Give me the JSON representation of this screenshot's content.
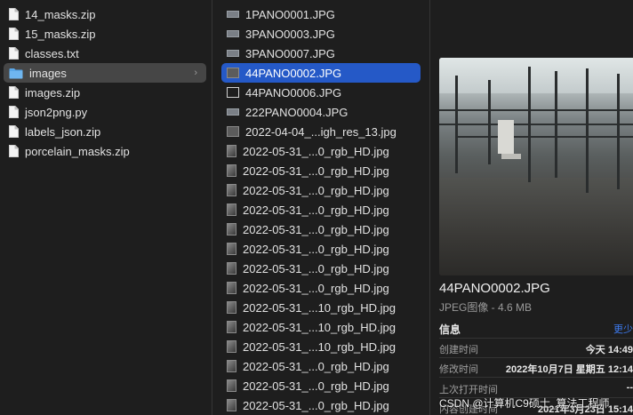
{
  "sidebar": {
    "items": [
      {
        "label": "14_masks.zip",
        "icon": "document-icon"
      },
      {
        "label": "15_masks.zip",
        "icon": "document-icon"
      },
      {
        "label": "classes.txt",
        "icon": "document-icon"
      },
      {
        "label": "images",
        "icon": "folder-icon",
        "selected": true
      },
      {
        "label": "images.zip",
        "icon": "document-icon"
      },
      {
        "label": "json2png.py",
        "icon": "document-icon"
      },
      {
        "label": "labels_json.zip",
        "icon": "document-icon"
      },
      {
        "label": "porcelain_masks.zip",
        "icon": "document-icon"
      }
    ],
    "chevron": "›"
  },
  "files": {
    "items": [
      {
        "label": "1PANO0001.JPG",
        "thumb": "pano"
      },
      {
        "label": "3PANO0003.JPG",
        "thumb": "pano"
      },
      {
        "label": "3PANO0007.JPG",
        "thumb": "pano"
      },
      {
        "label": "44PANO0002.JPG",
        "thumb": "dark",
        "selected": true
      },
      {
        "label": "44PANO0006.JPG",
        "thumb": "white"
      },
      {
        "label": "222PANO0004.JPG",
        "thumb": "pano"
      },
      {
        "label": "2022-04-04_...igh_res_13.jpg",
        "thumb": "dark"
      },
      {
        "label": "2022-05-31_...0_rgb_HD.jpg",
        "thumb": "portrait"
      },
      {
        "label": "2022-05-31_...0_rgb_HD.jpg",
        "thumb": "portrait"
      },
      {
        "label": "2022-05-31_...0_rgb_HD.jpg",
        "thumb": "portrait"
      },
      {
        "label": "2022-05-31_...0_rgb_HD.jpg",
        "thumb": "portrait"
      },
      {
        "label": "2022-05-31_...0_rgb_HD.jpg",
        "thumb": "portrait"
      },
      {
        "label": "2022-05-31_...0_rgb_HD.jpg",
        "thumb": "portrait"
      },
      {
        "label": "2022-05-31_...0_rgb_HD.jpg",
        "thumb": "portrait"
      },
      {
        "label": "2022-05-31_...0_rgb_HD.jpg",
        "thumb": "portrait"
      },
      {
        "label": "2022-05-31_...10_rgb_HD.jpg",
        "thumb": "portrait"
      },
      {
        "label": "2022-05-31_...10_rgb_HD.jpg",
        "thumb": "portrait"
      },
      {
        "label": "2022-05-31_...10_rgb_HD.jpg",
        "thumb": "portrait"
      },
      {
        "label": "2022-05-31_...0_rgb_HD.jpg",
        "thumb": "portrait"
      },
      {
        "label": "2022-05-31_...0_rgb_HD.jpg",
        "thumb": "portrait"
      },
      {
        "label": "2022-05-31_...0_rgb_HD.jpg",
        "thumb": "portrait"
      }
    ]
  },
  "preview": {
    "file_name": "44PANO0002.JPG",
    "file_kind": "JPEG图像 - 4.6 MB",
    "info_heading": "信息",
    "more_label": "更少",
    "meta": [
      {
        "key": "创建时间",
        "value": "今天 14:49"
      },
      {
        "key": "修改时间",
        "value": "2022年10月7日 星期五 12:14"
      },
      {
        "key": "上次打开时间",
        "value": "--"
      },
      {
        "key": "内容创建时间",
        "value": "2021年3月23日 15:14"
      }
    ]
  },
  "watermark": "CSDN @计算机C9硕士_算法工程师",
  "colors": {
    "selection_blue": "#2559c7",
    "selection_gray": "#464646",
    "link_blue": "#3d7bf0"
  }
}
